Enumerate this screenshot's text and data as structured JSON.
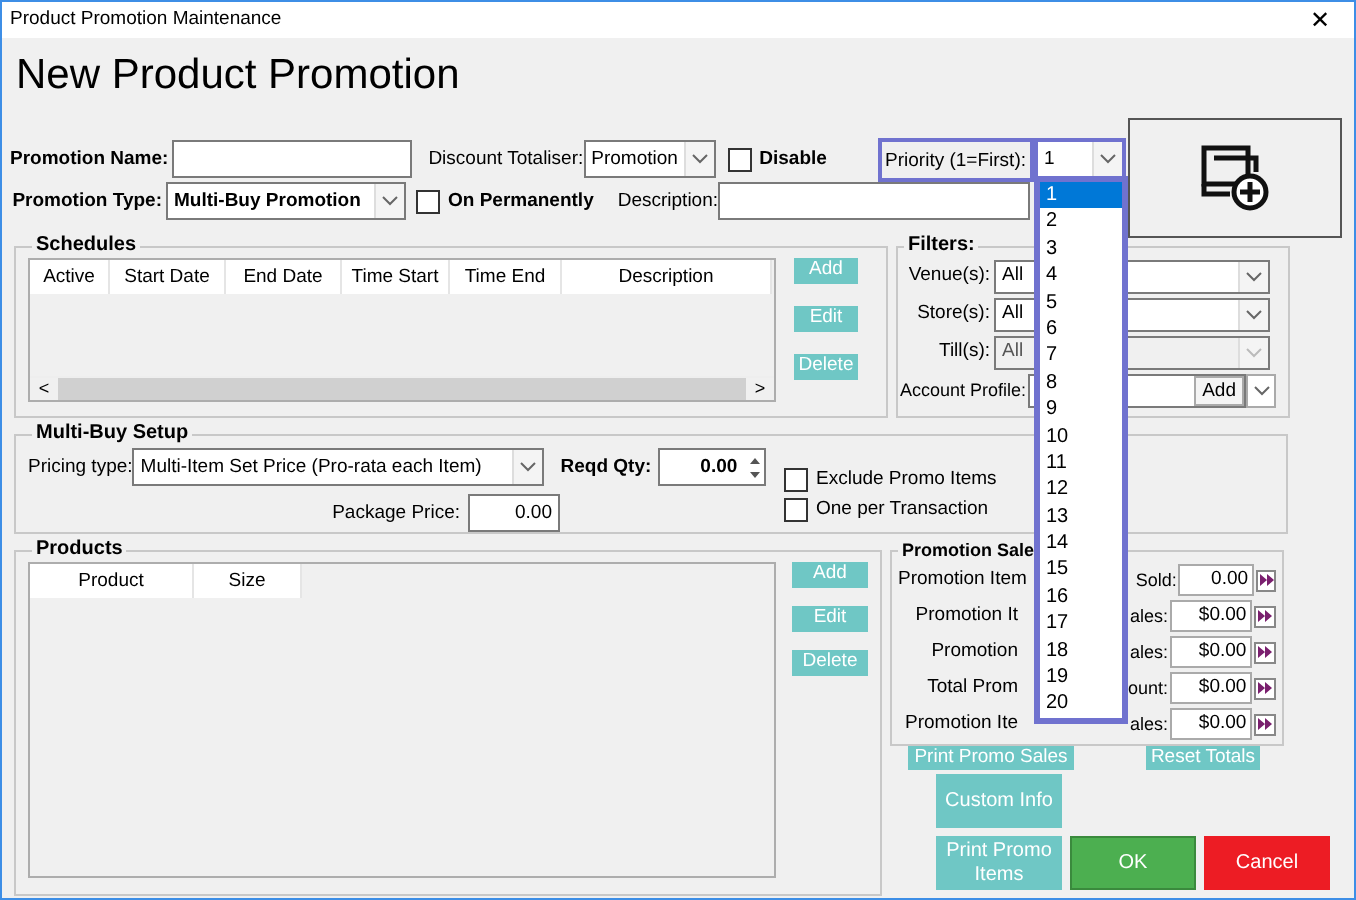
{
  "window": {
    "title": "Product Promotion Maintenance",
    "close": "✕"
  },
  "heading": "New Product Promotion",
  "promotion_name": {
    "label": "Promotion Name:"
  },
  "discount_totaliser": {
    "label": "Discount Totaliser:",
    "value": "Promotion"
  },
  "disable": {
    "label": "Disable",
    "checked": false
  },
  "priority": {
    "label": "Priority (1=First):",
    "value": "1"
  },
  "promotion_type": {
    "label": "Promotion Type:",
    "value": "Multi-Buy Promotion"
  },
  "on_permanently": {
    "label": "On Permanently",
    "checked": false
  },
  "description": {
    "label": "Description:"
  },
  "schedules": {
    "title": "Schedules",
    "columns": [
      "Active",
      "Start Date",
      "End Date",
      "Time Start",
      "Time End",
      "Description"
    ],
    "scroll_left": "<",
    "scroll_right": ">",
    "buttons": [
      "Add",
      "Edit",
      "Delete"
    ]
  },
  "filters": {
    "title": "Filters:",
    "rows": [
      {
        "label": "Venue(s):",
        "value": "All",
        "disabled": false
      },
      {
        "label": "Store(s):",
        "value": "All",
        "disabled": false
      },
      {
        "label": "Till(s):",
        "value": "All",
        "disabled": true
      }
    ],
    "account_profile": {
      "label": "Account Profile:",
      "button": "Add"
    }
  },
  "multi_buy": {
    "title": "Multi-Buy Setup",
    "pricing_type": {
      "label": "Pricing type:",
      "value": "Multi-Item Set Price (Pro-rata each Item)"
    },
    "reqd_qty": {
      "label": "Reqd Qty:",
      "value": "0.00"
    },
    "package_price": {
      "label": "Package Price:",
      "value": "0.00"
    },
    "options": [
      {
        "label": "Exclude Promo Items",
        "checked": false
      },
      {
        "label": "One per Transaction",
        "checked": false
      }
    ]
  },
  "products": {
    "title": "Products",
    "columns": [
      "Product",
      "Size"
    ],
    "buttons": [
      "Add",
      "Edit",
      "Delete"
    ]
  },
  "promotion_sales": {
    "title": "Promotion Sale",
    "rows": [
      {
        "label_start": "Promotion Item",
        "label_end": "Sold:",
        "value": "0.00"
      },
      {
        "label_start": "Promotion It",
        "label_end": "ales:",
        "value": "$0.00"
      },
      {
        "label_start": "Promotion",
        "label_end": "ales:",
        "value": "$0.00"
      },
      {
        "label_start": "Total Prom",
        "label_end": "ount:",
        "value": "$0.00"
      },
      {
        "label_start": "Promotion Ite",
        "label_end": "ales:",
        "value": "$0.00"
      }
    ],
    "buttons": [
      "Print Promo Sales",
      "Reset Totals"
    ]
  },
  "actions": [
    {
      "label": "Custom Info",
      "kind": "info"
    },
    {
      "label": "Print Promo Items",
      "kind": "info"
    },
    {
      "label": "OK",
      "kind": "ok"
    },
    {
      "label": "Cancel",
      "kind": "cancel"
    }
  ],
  "priority_list": {
    "items": [
      {
        "label": "1",
        "selected": true
      },
      {
        "label": "2",
        "selected": false
      },
      {
        "label": "3",
        "selected": false
      },
      {
        "label": "4",
        "selected": false
      },
      {
        "label": "5",
        "selected": false
      },
      {
        "label": "6",
        "selected": false
      },
      {
        "label": "7",
        "selected": false
      },
      {
        "label": "8",
        "selected": false
      },
      {
        "label": "9",
        "selected": false
      },
      {
        "label": "10",
        "selected": false
      },
      {
        "label": "11",
        "selected": false
      },
      {
        "label": "12",
        "selected": false
      },
      {
        "label": "13",
        "selected": false
      },
      {
        "label": "14",
        "selected": false
      },
      {
        "label": "15",
        "selected": false
      },
      {
        "label": "16",
        "selected": false
      },
      {
        "label": "17",
        "selected": false
      },
      {
        "label": "18",
        "selected": false
      },
      {
        "label": "19",
        "selected": false
      },
      {
        "label": "20",
        "selected": false
      }
    ]
  }
}
